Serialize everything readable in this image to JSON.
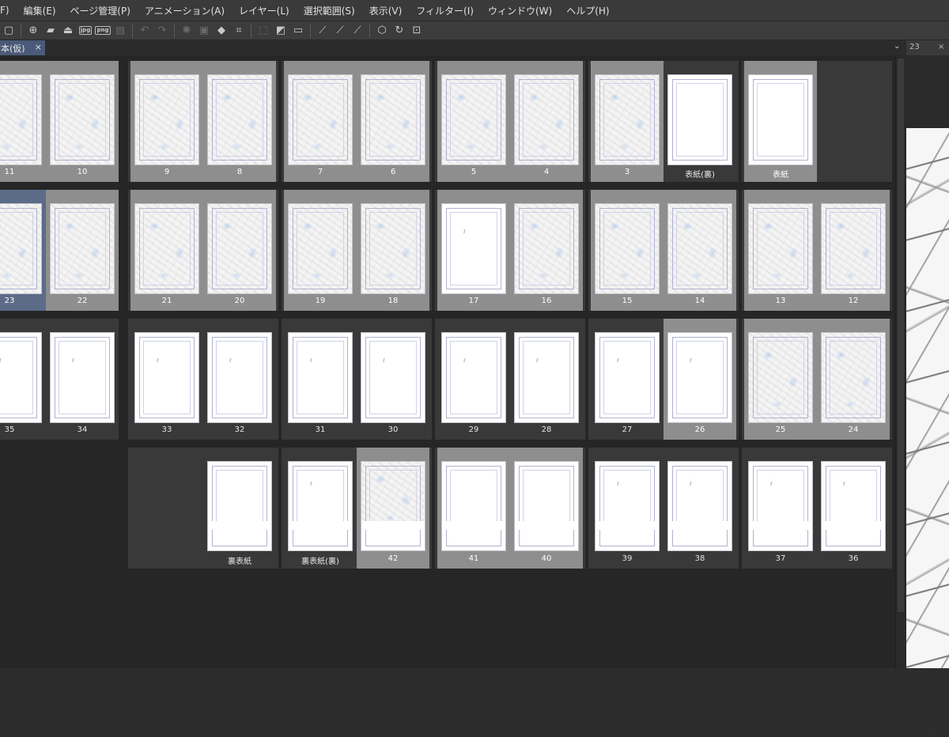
{
  "menu": [
    "F)",
    "編集(E)",
    "ページ管理(P)",
    "アニメーション(A)",
    "レイヤー(L)",
    "選択範囲(S)",
    "表示(V)",
    "フィルター(I)",
    "ウィンドウ(W)",
    "ヘルプ(H)"
  ],
  "toolbar": {
    "icons": [
      "open-icon",
      "new-page-icon",
      "folder-icon",
      "export-icon",
      "jpg-export-icon",
      "png-export-icon",
      "print-icon",
      "undo-icon",
      "redo-icon",
      "busy-icon",
      "transform-icon",
      "fill-icon",
      "crop-icon",
      "deselect-icon",
      "tone-icon",
      "border-icon",
      "ruler-icon",
      "ruler2-icon",
      "ruler3-icon",
      "snap-icon",
      "rotate-icon",
      "grid-icon"
    ],
    "jpg": "jpg",
    "png": "png"
  },
  "document_tab": {
    "label": "本(仮)",
    "close": "×"
  },
  "right_pane": {
    "tab_label": "23",
    "close": "×",
    "page_number": "23"
  },
  "pages": {
    "r1": [
      "11",
      "10",
      "9",
      "8",
      "7",
      "6",
      "5",
      "4",
      "3",
      "表紙(裏)",
      "表紙"
    ],
    "r2": [
      "23",
      "22",
      "21",
      "20",
      "19",
      "18",
      "17",
      "16",
      "15",
      "14",
      "13",
      "12"
    ],
    "r3": [
      "35",
      "34",
      "33",
      "32",
      "31",
      "30",
      "29",
      "28",
      "27",
      "26",
      "25",
      "24"
    ],
    "r4": [
      "裏表紙",
      "裏表紙(裏)",
      "42",
      "41",
      "40",
      "39",
      "38",
      "37",
      "36"
    ]
  },
  "colors": {
    "menubar": "#3a3a3a",
    "selected_page": "#8e8e8e",
    "current_page": "#5b6b88",
    "spread_bg": "#393939"
  }
}
